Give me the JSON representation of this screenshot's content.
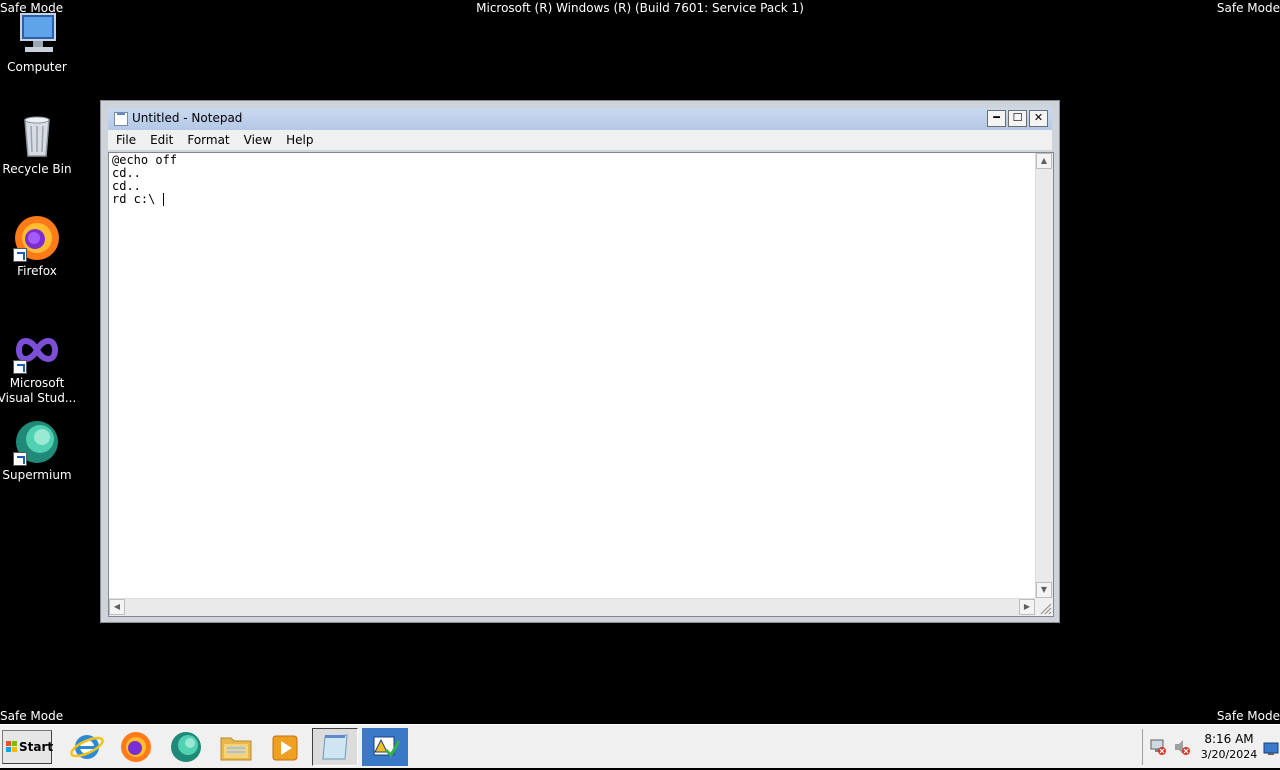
{
  "screen": {
    "safe_mode_label": "Safe Mode",
    "build_info": "Microsoft (R) Windows (R) (Build 7601: Service Pack 1)"
  },
  "desktop_icons": [
    {
      "label": "Computer",
      "icon": "computer-icon"
    },
    {
      "label": "Recycle Bin",
      "icon": "recycle-bin-icon"
    },
    {
      "label": "Firefox",
      "icon": "firefox-icon"
    },
    {
      "label": "Microsoft Visual Stud...",
      "icon": "visual-studio-icon"
    },
    {
      "label": "Supermium",
      "icon": "supermium-icon"
    }
  ],
  "notepad": {
    "title": "Untitled - Notepad",
    "menu": [
      "File",
      "Edit",
      "Format",
      "View",
      "Help"
    ],
    "lines": [
      "@echo off",
      "cd..",
      "cd..",
      "rd c:\\ "
    ],
    "buttons": {
      "minimize": "minimize-icon",
      "maximize": "maximize-icon",
      "close": "close-icon"
    }
  },
  "taskbar": {
    "start_label": "Start",
    "apps": [
      "internet-explorer-icon",
      "firefox-icon",
      "supermium-icon",
      "file-explorer-icon",
      "media-player-icon",
      "notepad-icon",
      "action-center-icon"
    ],
    "clock_time": "8:16 AM",
    "clock_date": "3/20/2024",
    "tray_icons": [
      "network-disconnected-icon",
      "volume-muted-icon",
      "show-desktop-icon"
    ]
  },
  "colors": {
    "desktop_background": "#000000",
    "titlebar": "#b9cde9",
    "taskbar": "#f0f0f0"
  }
}
